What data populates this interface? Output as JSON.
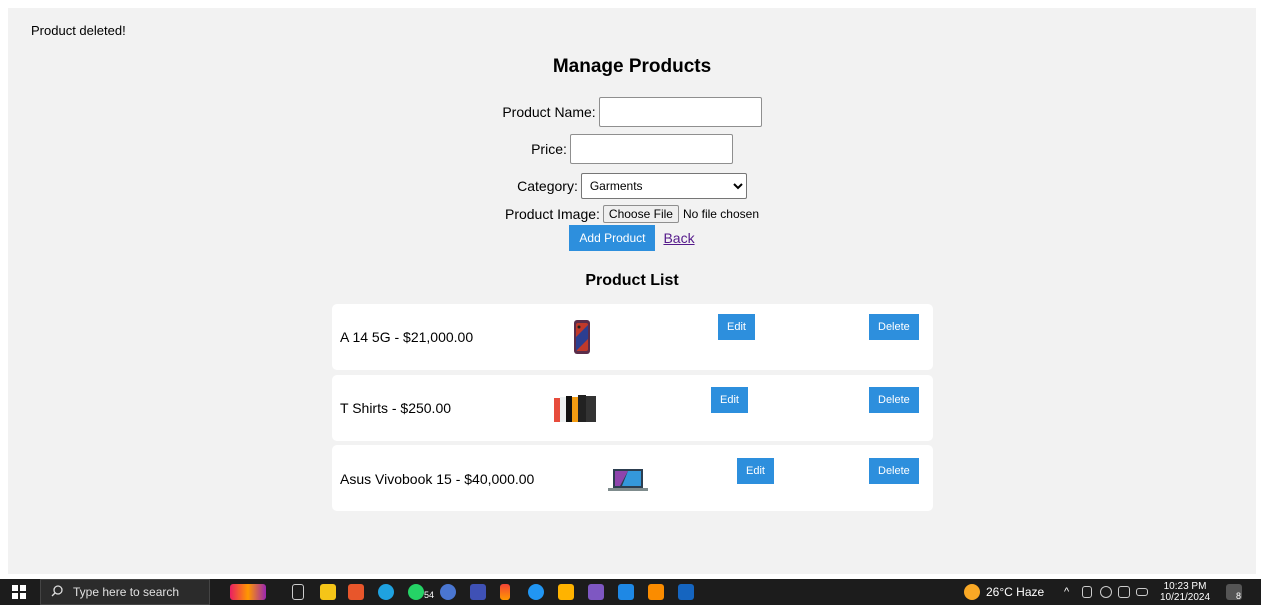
{
  "flash_message": "Product deleted!",
  "title": "Manage Products",
  "form": {
    "name_label": "Product Name:",
    "name_value": "",
    "price_label": "Price:",
    "price_value": "",
    "category_label": "Category:",
    "category_selected": "Garments",
    "image_label": "Product Image:",
    "choose_file_label": "Choose File",
    "no_file_text": "No file chosen",
    "add_button": "Add Product",
    "back_link": "Back"
  },
  "list_title": "Product List",
  "products": [
    {
      "label": "A 14 5G - $21,000.00",
      "edit": "Edit",
      "delete": "Delete",
      "thumb_icon": "smartphone-image"
    },
    {
      "label": "T Shirts - $250.00",
      "edit": "Edit",
      "delete": "Delete",
      "thumb_icon": "tshirts-image"
    },
    {
      "label": "Asus Vivobook 15 - $40,000.00",
      "edit": "Edit",
      "delete": "Delete",
      "thumb_icon": "laptop-image"
    }
  ],
  "taskbar": {
    "search_placeholder": "Type here to search",
    "weather": "26°C  Haze",
    "time": "10:23 PM",
    "date": "10/21/2024",
    "whatsapp_badge": "54",
    "notification_count": "8"
  },
  "colors": {
    "accent_button": "#2d8fdd",
    "page_background": "#f2f2f2",
    "card_background": "#ffffff",
    "link": "#551a8b"
  }
}
